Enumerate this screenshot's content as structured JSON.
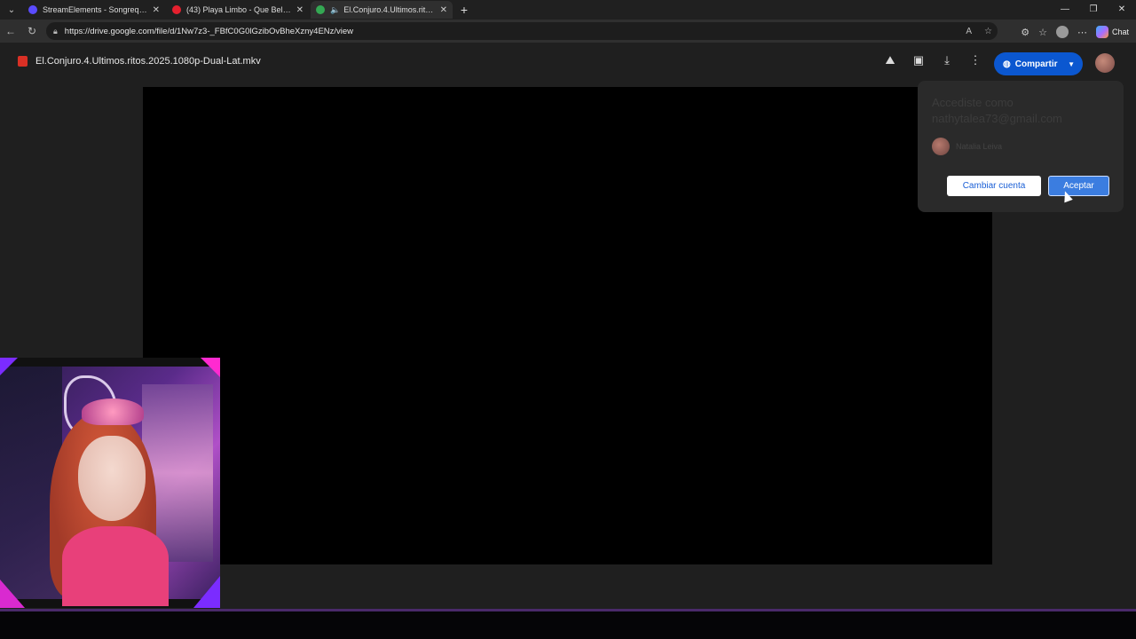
{
  "browser": {
    "tabs": [
      {
        "title": "StreamElements - Songrequest",
        "fav_color": "#5a4bff"
      },
      {
        "title": "(43) Playa Limbo - Que Bello - Yo",
        "fav_color": "#e5202e"
      },
      {
        "title": "El.Conjuro.4.Ultimos.ritos.20",
        "fav_color": "#34a853",
        "active": true
      }
    ],
    "new_tab_label": "+",
    "url": "https://drive.google.com/file/d/1Nw7z3-_FBfC0G0lGzibOvBheXzny4ENz/view",
    "chat_label": "Chat"
  },
  "drive": {
    "file_name": "El.Conjuro.4.Ultimos.ritos.2025.1080p-Dual-Lat.mkv",
    "share_label": "Compartir",
    "top_icons": [
      "add-to-drive-icon",
      "comment-icon",
      "download-icon",
      "more-vert-icon"
    ]
  },
  "popup": {
    "message": "Accediste como nathytalea73@gmail.com",
    "account_name": "Natalia Leiva",
    "switch_label": "Cambiar cuenta",
    "accept_label": "Aceptar"
  },
  "colors": {
    "accent": "#0b57d0",
    "accept_button": "#3b7de0",
    "page_bg": "#1f1f1f"
  }
}
